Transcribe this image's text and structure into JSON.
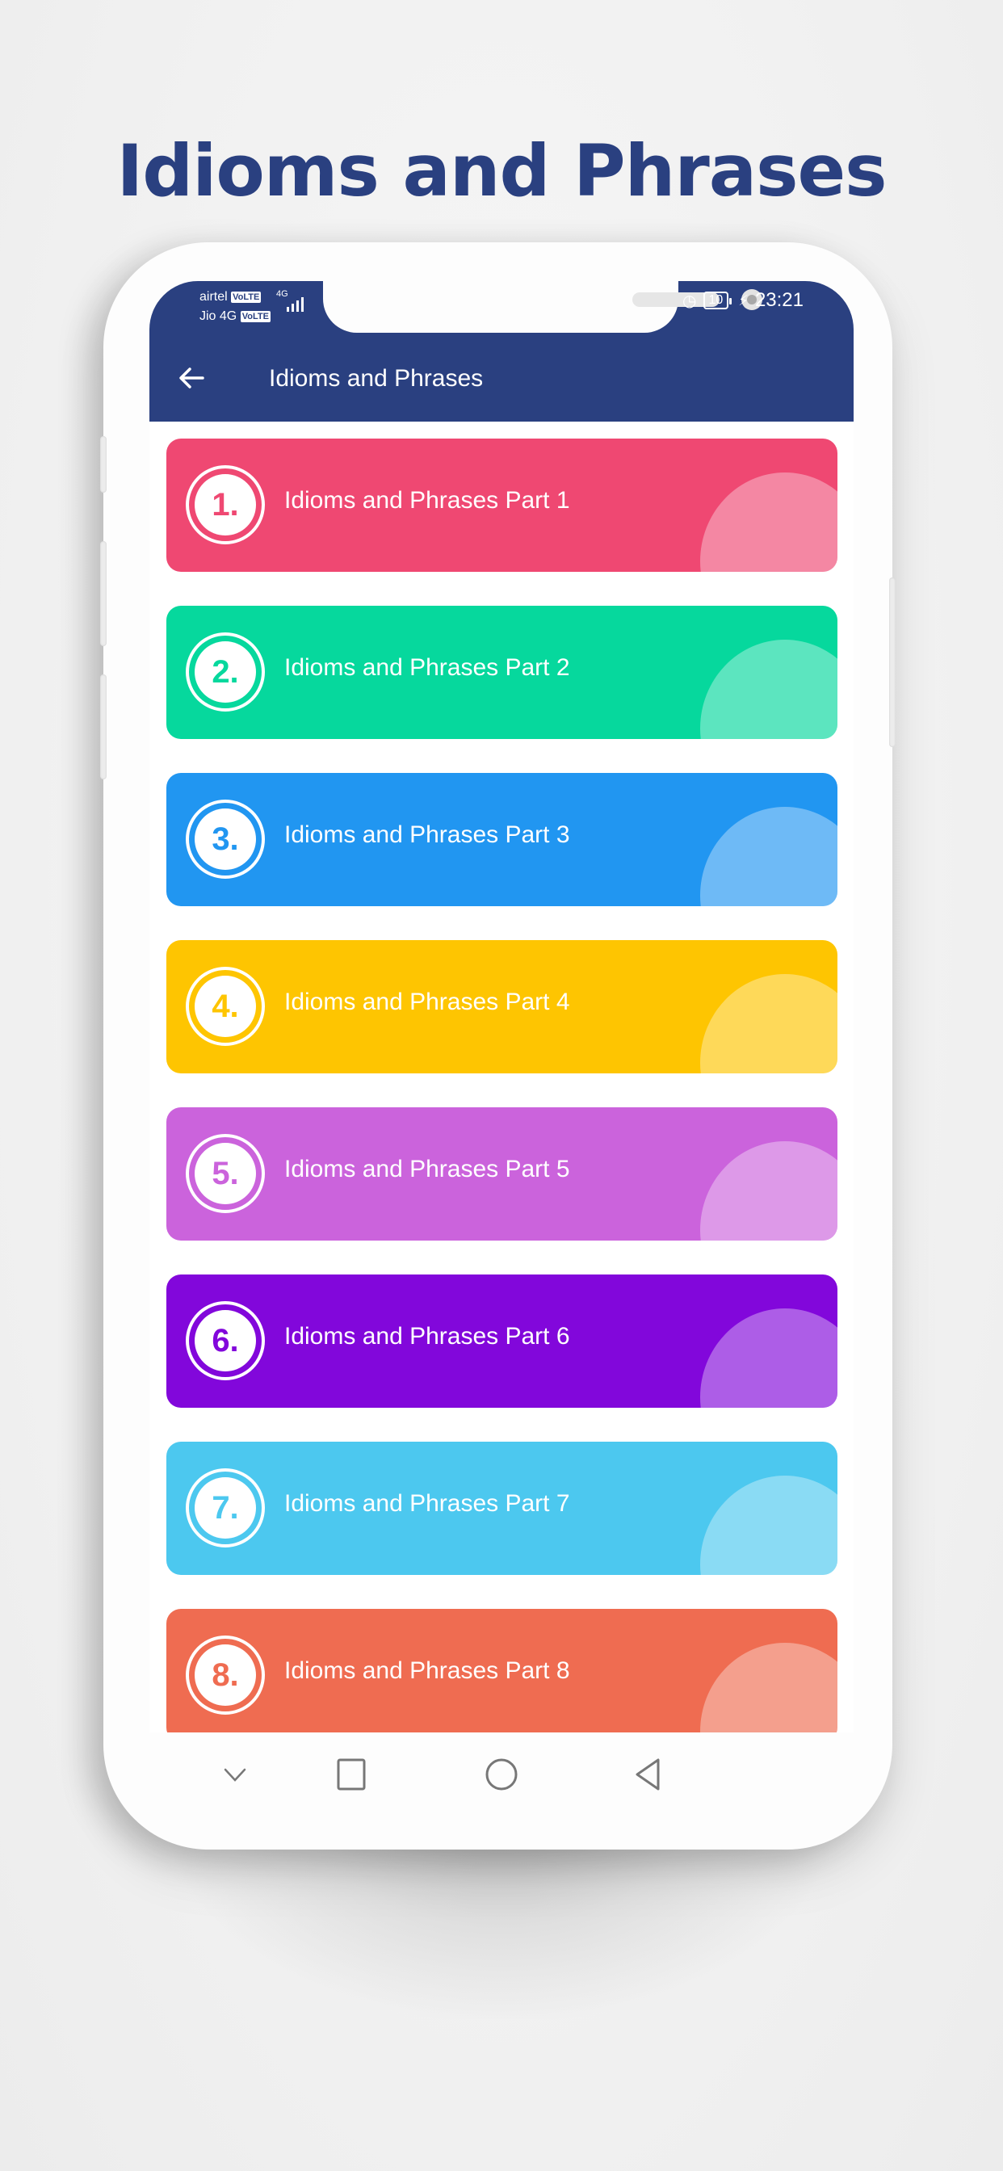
{
  "headline": "Idioms and Phrases",
  "status_bar": {
    "carrier_1": "airtel",
    "carrier_1_tag": "VoLTE",
    "carrier_2": "Jio 4G",
    "carrier_2_tag": "VoLTE",
    "network": "4G",
    "battery": "10",
    "time": "23:21"
  },
  "app_bar": {
    "title": "Idioms and Phrases",
    "back_icon": "arrow-left-icon",
    "color": "#2a4080"
  },
  "items": [
    {
      "number": "1.",
      "label": "Idioms and Phrases Part 1",
      "color": "#ef4872"
    },
    {
      "number": "2.",
      "label": "Idioms and Phrases Part 2",
      "color": "#06d89d"
    },
    {
      "number": "3.",
      "label": "Idioms and Phrases Part 3",
      "color": "#2196f1"
    },
    {
      "number": "4.",
      "label": "Idioms and Phrases Part 4",
      "color": "#fec501"
    },
    {
      "number": "5.",
      "label": "Idioms and Phrases Part 5",
      "color": "#cb63dc"
    },
    {
      "number": "6.",
      "label": "Idioms and Phrases Part 6",
      "color": "#8207db"
    },
    {
      "number": "7.",
      "label": "Idioms and Phrases Part 7",
      "color": "#4cc8ef"
    },
    {
      "number": "8.",
      "label": "Idioms and Phrases Part 8",
      "color": "#ef6c51"
    }
  ],
  "nav_bar": [
    "chevron-down-icon",
    "recents-square-icon",
    "home-circle-icon",
    "back-triangle-icon"
  ]
}
